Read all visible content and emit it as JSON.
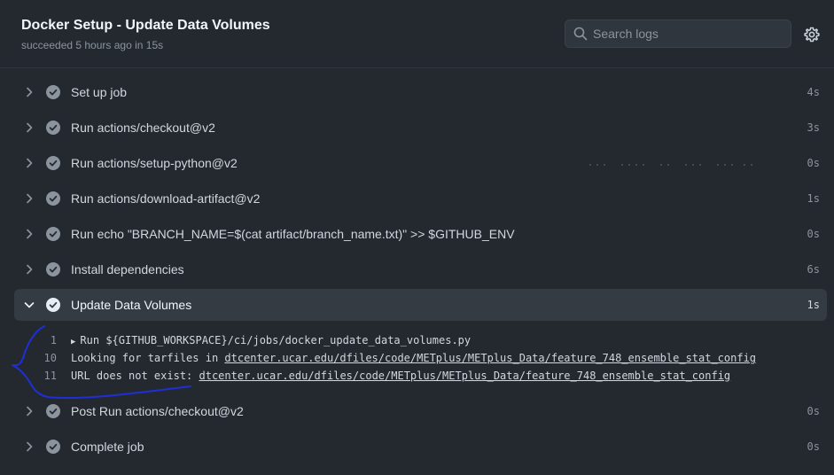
{
  "header": {
    "title": "Docker Setup - Update Data Volumes",
    "subtitle": "succeeded 5 hours ago in 15s",
    "search_placeholder": "Search logs"
  },
  "icons": {
    "search": "search-icon",
    "settings": "gear-icon",
    "step_status": "check-circle-icon",
    "expand": "chevron-right-icon",
    "collapse": "chevron-down-icon"
  },
  "steps": [
    {
      "name": "Set up job",
      "duration": "4s"
    },
    {
      "name": "Run actions/checkout@v2",
      "duration": "3s"
    },
    {
      "name": "Run actions/setup-python@v2",
      "duration": "0s"
    },
    {
      "name": "Run actions/download-artifact@v2",
      "duration": "1s"
    },
    {
      "name": "Run echo \"BRANCH_NAME=$(cat artifact/branch_name.txt)\" >> $GITHUB_ENV",
      "duration": "0s"
    },
    {
      "name": "Install dependencies",
      "duration": "6s"
    },
    {
      "name": "Update Data Volumes",
      "duration": "1s"
    },
    {
      "name": "Post Run actions/checkout@v2",
      "duration": "0s"
    },
    {
      "name": "Complete job",
      "duration": "0s"
    }
  ],
  "log_lines": [
    {
      "num": "1",
      "text": "Run ${GITHUB_WORKSPACE}/ci/jobs/docker_update_data_volumes.py"
    },
    {
      "num": "10",
      "prefix": "Looking for tarfiles in ",
      "link": "dtcenter.ucar.edu/dfiles/code/METplus/METplus_Data/feature_748_ensemble_stat_config"
    },
    {
      "num": "11",
      "prefix": "URL does not exist: ",
      "link": "dtcenter.ucar.edu/dfiles/code/METplus/METplus_Data/feature_748_ensemble_stat_config"
    }
  ],
  "colors": {
    "background": "#24292f",
    "active_row": "#343b43",
    "check": "#8b949e",
    "annotation": "#1f2fd6"
  }
}
